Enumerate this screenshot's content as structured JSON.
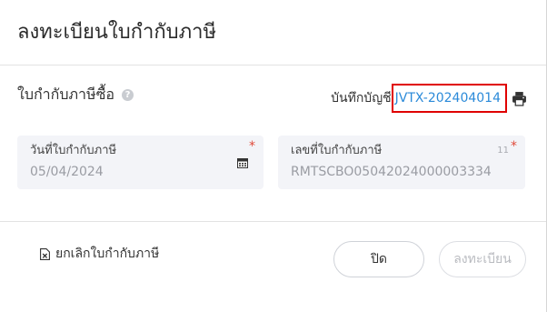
{
  "dialog": {
    "title": "ลงทะเบียนใบกำกับภาษี"
  },
  "section": {
    "title": "ใบกำกับภาษีซื้อ",
    "help_icon": "question-circle-icon",
    "journal_label": "บันทึกบัญชี",
    "journal_link": "JVTX-202404014",
    "print_icon": "printer-icon"
  },
  "fields": {
    "date": {
      "label": "วันที่ใบกำกับภาษี",
      "value": "05/04/2024",
      "required_mark": "*",
      "icon": "calendar-icon"
    },
    "number": {
      "label": "เลขที่ใบกำกับภาษี",
      "value": "RMTSCBO05042024000003334",
      "counter": "11",
      "required_mark": "*"
    }
  },
  "footer": {
    "cancel_label": "ยกเลิกใบกำกับภาษี",
    "cancel_icon": "document-x-icon",
    "close_label": "ปิด",
    "register_label": "ลงทะเบียน"
  },
  "colors": {
    "link": "#2b8ad9",
    "highlight_border": "#e00000",
    "required": "#e04a3a",
    "field_bg": "#f3f4f8"
  }
}
